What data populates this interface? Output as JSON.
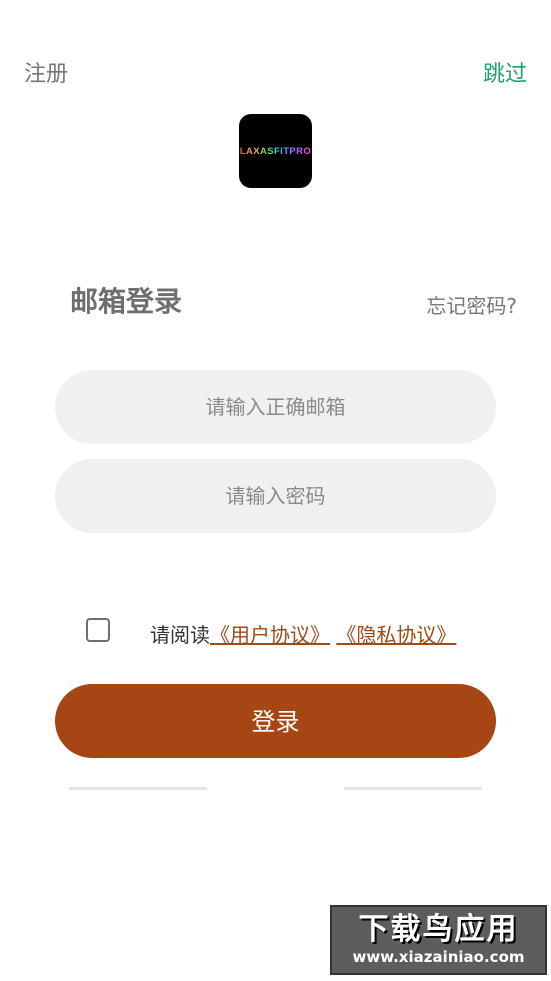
{
  "header": {
    "register_label": "注册",
    "skip_label": "跳过"
  },
  "logo": {
    "text": "LAXASFITPRO"
  },
  "login_form": {
    "title": "邮箱登录",
    "forgot_password": "忘记密码?",
    "email_placeholder": "请输入正确邮箱",
    "email_value": "",
    "password_placeholder": "请输入密码",
    "password_value": "",
    "agreement_checked": false,
    "agreement_prefix": "请阅读",
    "user_agreement_link": "《用户协议》",
    "privacy_link": "《隐私协议》",
    "login_button": "登录"
  },
  "watermark": {
    "title": "下载鸟应用",
    "url": "www.xiazainiao.com"
  },
  "colors": {
    "accent_green": "#1ea36e",
    "primary_button": "#a64614",
    "link": "#a24a16",
    "input_bg": "#f0f0f0"
  }
}
